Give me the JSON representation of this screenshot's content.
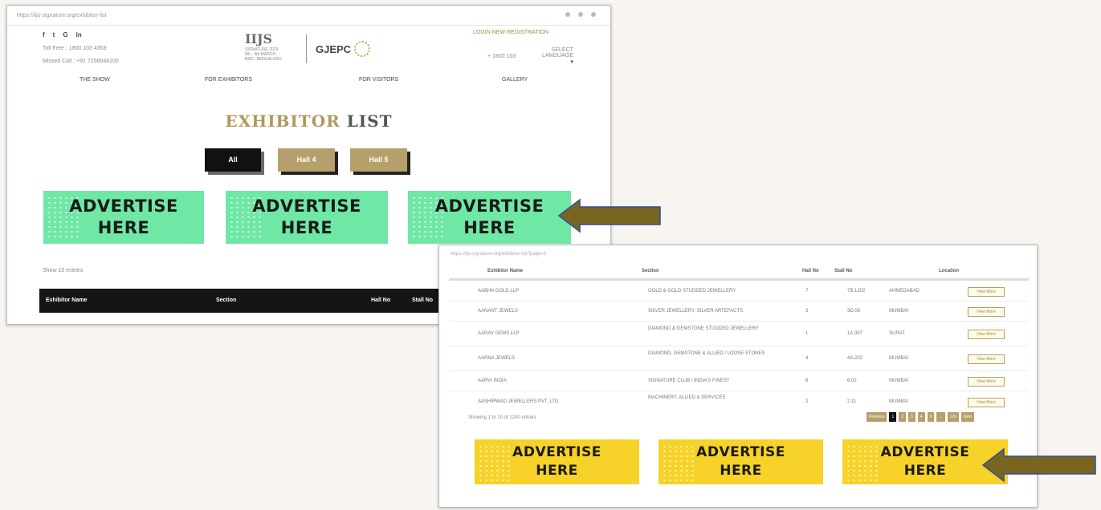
{
  "top_screenshot": {
    "url": "https://iijs-signature.org/exhibitor-list",
    "social": [
      "f",
      "t",
      "G",
      "in"
    ],
    "contact": {
      "toll_free_label": "Toll Free :",
      "toll_free": "1800 103 4353",
      "missed_call_label": "Missed Call :",
      "missed_call": "+91 7208048100"
    },
    "logo": {
      "ijs": "IIJS",
      "sub_line1": "SIGNATURE 2023",
      "sub_line2": "5th - 9th MARCH",
      "sub_line3": "BIEC, BENGALURU",
      "partner": "GJEPC"
    },
    "login": "LOGIN  NEW REGISTRATION",
    "header_right": {
      "left": "+ 1800 103",
      "right_line1": "SELECT",
      "right_line2": "LANGUAGE"
    },
    "nav": [
      "THE SHOW",
      "FOR EXHIBITORS",
      "FOR VISITORS",
      "GALLERY"
    ],
    "title_part1": "EXHIBITOR",
    "title_part2": "LIST",
    "filters": [
      "All",
      "Hall 4",
      "Hall 5"
    ],
    "ads": [
      {
        "line1": "ADVERTISE",
        "line2": "HERE"
      },
      {
        "line1": "ADVERTISE",
        "line2": "HERE"
      },
      {
        "line1": "ADVERTISE",
        "line2": "HERE"
      }
    ],
    "show_entries": "Show  10  entries",
    "table_headers": [
      "Exhibitor Name",
      "Section",
      "Hall No",
      "Stall No"
    ]
  },
  "bottom_screenshot": {
    "url": "https://iijs-signature.org/exhibitor-list?page=1",
    "table_headers": [
      "Exhibitor Name",
      "Section",
      "Hall No",
      "Stall No",
      "Location"
    ],
    "rows": [
      {
        "name": "AABHA GOLD LLP",
        "section": "GOLD & GOLD STUDDED JEWELLERY",
        "hall": "7",
        "stall": "7B.1202",
        "location": "AHMEDABAD",
        "action": "View More"
      },
      {
        "name": "AANANT JEWELS",
        "section": "SILVER JEWELLERY, SILVER ARTEFACTS",
        "hall": "3",
        "stall": "3D.06",
        "location": "MUMBAI",
        "action": "View More"
      },
      {
        "name": "AARAV GEMS LLP",
        "section": "DIAMOND & GEMSTONE STUDDED JEWELLERY",
        "hall": "1",
        "stall": "1A.307",
        "location": "SURAT",
        "action": "View More"
      },
      {
        "name": "AARNA JEWELS",
        "section": "DIAMOND, GEMSTONE & ALLIED / LOOSE STONES",
        "hall": "4",
        "stall": "4A.202",
        "location": "MUMBAI",
        "action": "View More"
      },
      {
        "name": "AARVI INDIA",
        "section": "SIGNATURE CLUB / INDIA'S FINEST",
        "hall": "6",
        "stall": "6.02",
        "location": "MUMBAI",
        "action": "View More"
      },
      {
        "name": "AASHIRWAD JEWELLERS PVT. LTD.",
        "section": "MACHINERY, ALLIED & SERVICES",
        "hall": "2",
        "stall": "2.11",
        "location": "MUMBAI",
        "action": "View More"
      }
    ],
    "showing": "Showing 1 to 10 of 1200 entries",
    "pager": [
      "Previous",
      "1",
      "2",
      "3",
      "4",
      "5",
      "...",
      "120",
      "Next"
    ],
    "ads": [
      {
        "line1": "ADVERTISE",
        "line2": "HERE"
      },
      {
        "line1": "ADVERTISE",
        "line2": "HERE"
      },
      {
        "line1": "ADVERTISE",
        "line2": "HERE"
      }
    ]
  },
  "colors": {
    "green_ad": "#6fe8a6",
    "yellow_ad": "#f7d228",
    "gold": "#b5a06b",
    "arrow_fill": "#7a6520",
    "arrow_stroke": "#2f4f9a"
  }
}
